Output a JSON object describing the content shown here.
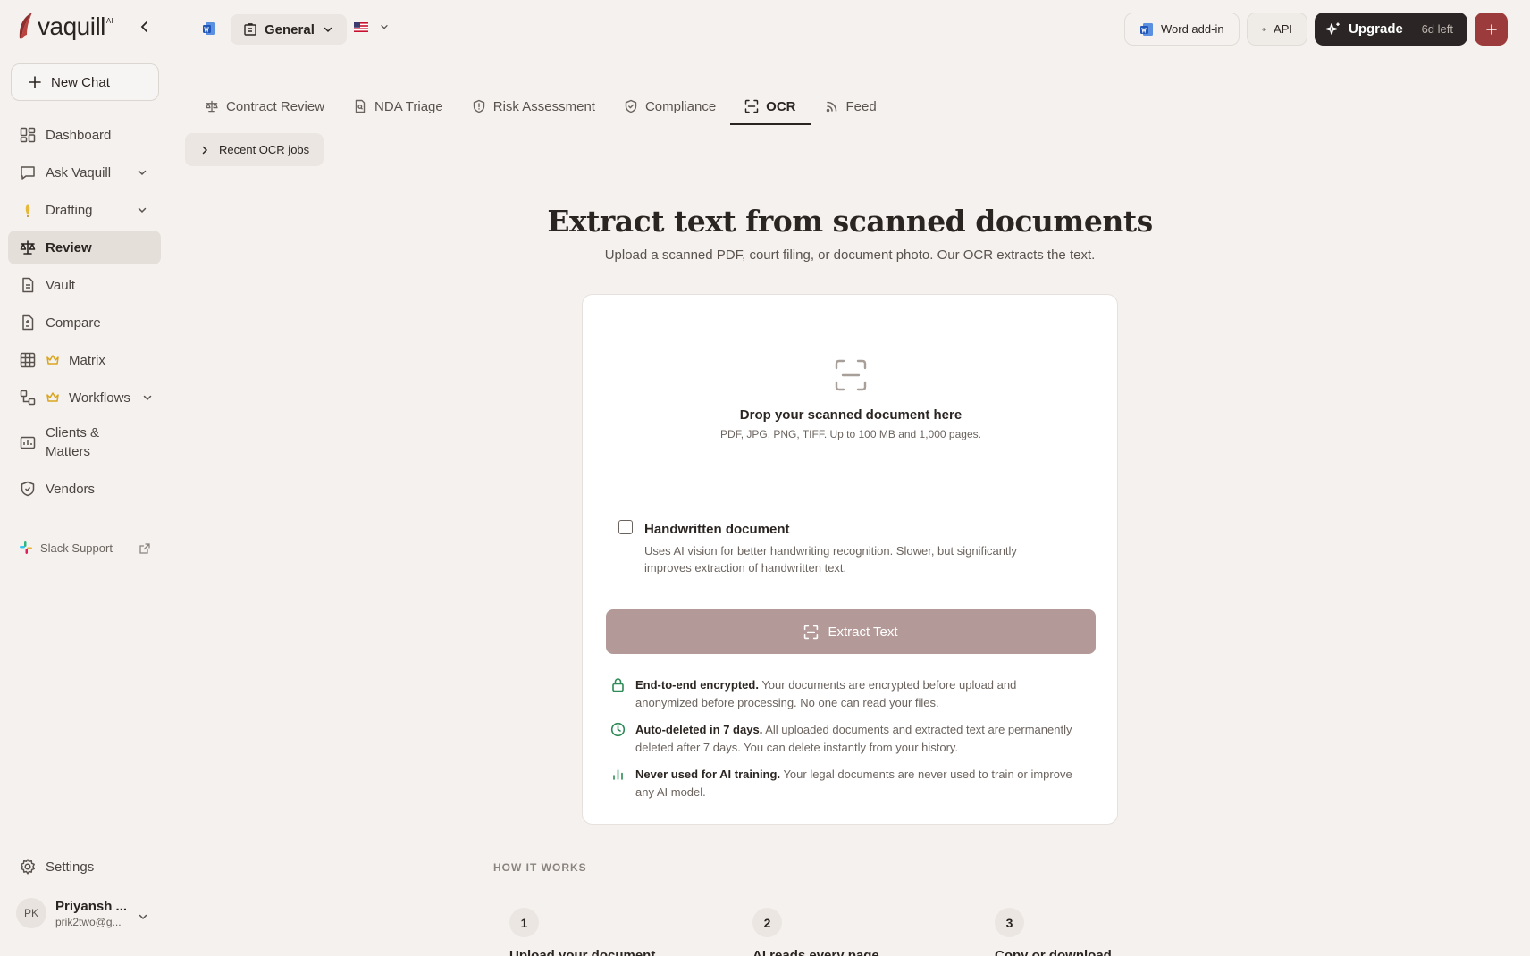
{
  "brand": {
    "name": "vaquill",
    "ai_tag": "AI"
  },
  "sidebar": {
    "new_chat": "New Chat",
    "items": [
      {
        "label": "Dashboard"
      },
      {
        "label": "Ask Vaquill"
      },
      {
        "label": "Drafting"
      },
      {
        "label": "Review"
      },
      {
        "label": "Vault"
      },
      {
        "label": "Compare"
      },
      {
        "label": "Matrix"
      },
      {
        "label": "Workflows"
      },
      {
        "label": "Clients & Matters"
      },
      {
        "label": "Vendors"
      }
    ],
    "slack_support": "Slack Support",
    "settings": "Settings",
    "user": {
      "initials": "PK",
      "name": "Priyansh ...",
      "email": "prik2two@g..."
    }
  },
  "topbar": {
    "workspace": "General",
    "word_addin": "Word add-in",
    "api": "API",
    "upgrade": "Upgrade",
    "days_left": "6d left"
  },
  "tabs": [
    {
      "label": "Contract Review"
    },
    {
      "label": "NDA Triage"
    },
    {
      "label": "Risk Assessment"
    },
    {
      "label": "Compliance"
    },
    {
      "label": "OCR"
    },
    {
      "label": "Feed"
    }
  ],
  "recent_jobs": "Recent OCR jobs",
  "hero": {
    "title": "Extract text from scanned documents",
    "subtitle": "Upload a scanned PDF, court filing, or document photo. Our OCR extracts the text."
  },
  "upload": {
    "drop_title": "Drop your scanned document here",
    "drop_sub": "PDF, JPG, PNG, TIFF. Up to 100 MB and 1,000 pages.",
    "handwritten_label": "Handwritten document",
    "handwritten_desc": "Uses AI vision for better handwriting recognition. Slower, but significantly improves extraction of handwritten text.",
    "extract_button": "Extract Text"
  },
  "features": [
    {
      "title": "End-to-end encrypted.",
      "text": " Your documents are encrypted before upload and anonymized before processing. No one can read your files."
    },
    {
      "title": "Auto-deleted in 7 days.",
      "text": " All uploaded documents and extracted text are permanently deleted after 7 days. You can delete instantly from your history."
    },
    {
      "title": "Never used for AI training.",
      "text": " Your legal documents are never used to train or improve any AI model."
    }
  ],
  "how_it_works": {
    "heading": "HOW IT WORKS",
    "steps": [
      {
        "num": "1",
        "label": "Upload your document"
      },
      {
        "num": "2",
        "label": "AI reads every page"
      },
      {
        "num": "3",
        "label": "Copy or download"
      }
    ]
  },
  "colors": {
    "accent": "#9c3b3b",
    "button_disabled": "#b39a98",
    "feature_green": "#2f8a57",
    "background": "#f4f1ee"
  }
}
